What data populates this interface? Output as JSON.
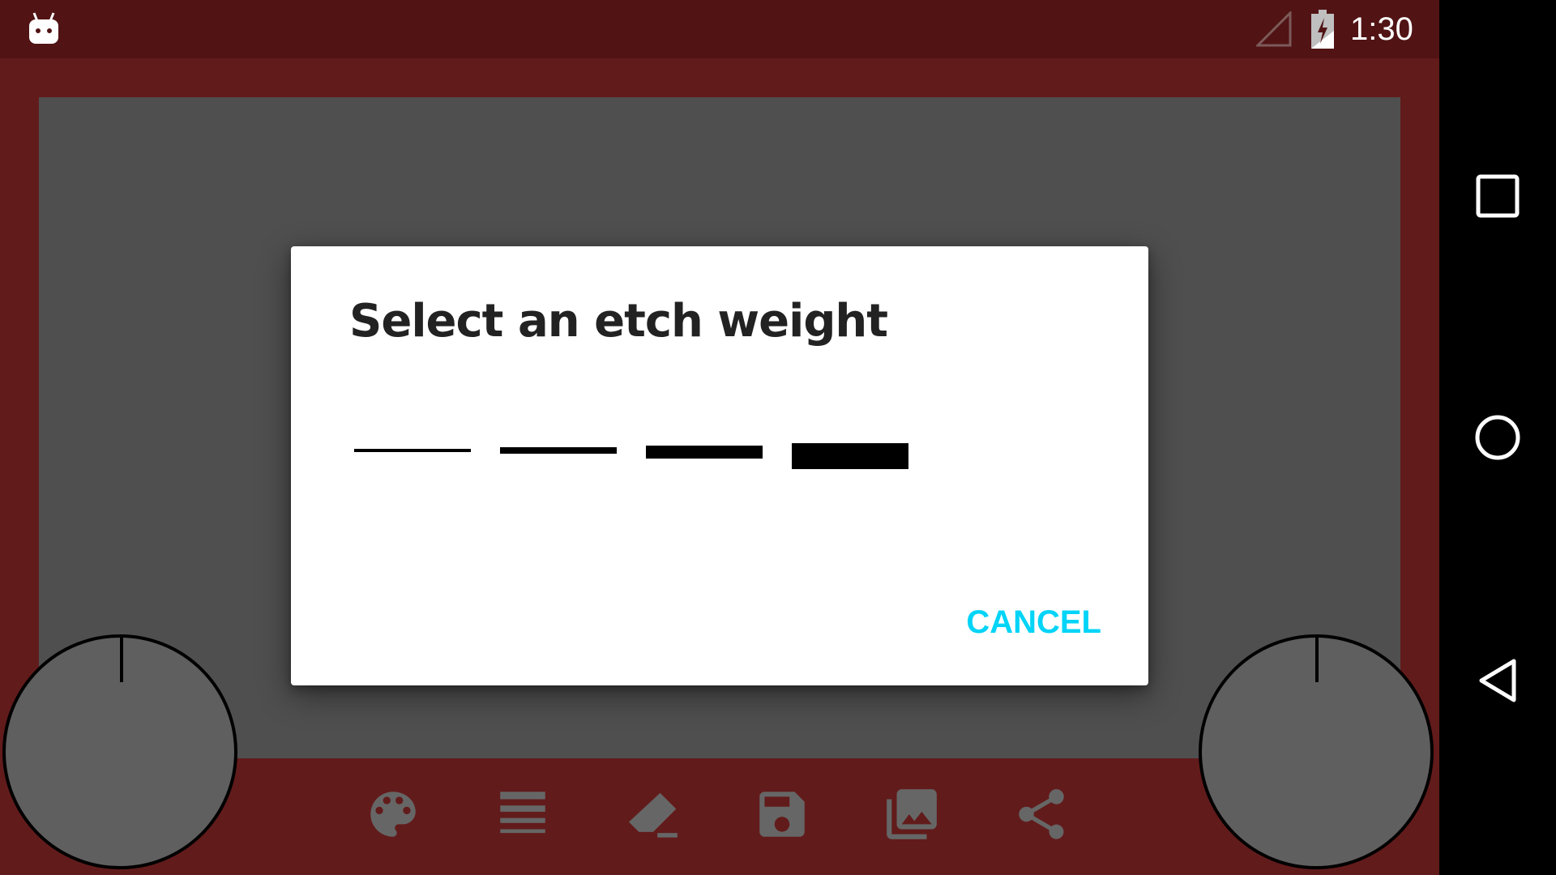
{
  "status_bar": {
    "time": "1:30",
    "icons": [
      "android-app-icon",
      "signal-icon",
      "battery-charging-icon"
    ]
  },
  "toolbar": {
    "tools": [
      "palette-icon",
      "line-weight-icon",
      "eraser-icon",
      "save-icon",
      "gallery-icon",
      "share-icon"
    ]
  },
  "dialog": {
    "title": "Select an etch weight",
    "weights": [
      1,
      2,
      3,
      4
    ],
    "cancel_label": "CANCEL"
  },
  "colors": {
    "status_bar": "#511314",
    "frame": "#621b1b",
    "canvas": "#4f4f4f",
    "accent": "#00d4f7",
    "icon_gray": "#666666",
    "knob_fill": "#5f5f5f"
  },
  "nav_bar": {
    "buttons": [
      "recents-icon",
      "home-icon",
      "back-icon"
    ]
  }
}
